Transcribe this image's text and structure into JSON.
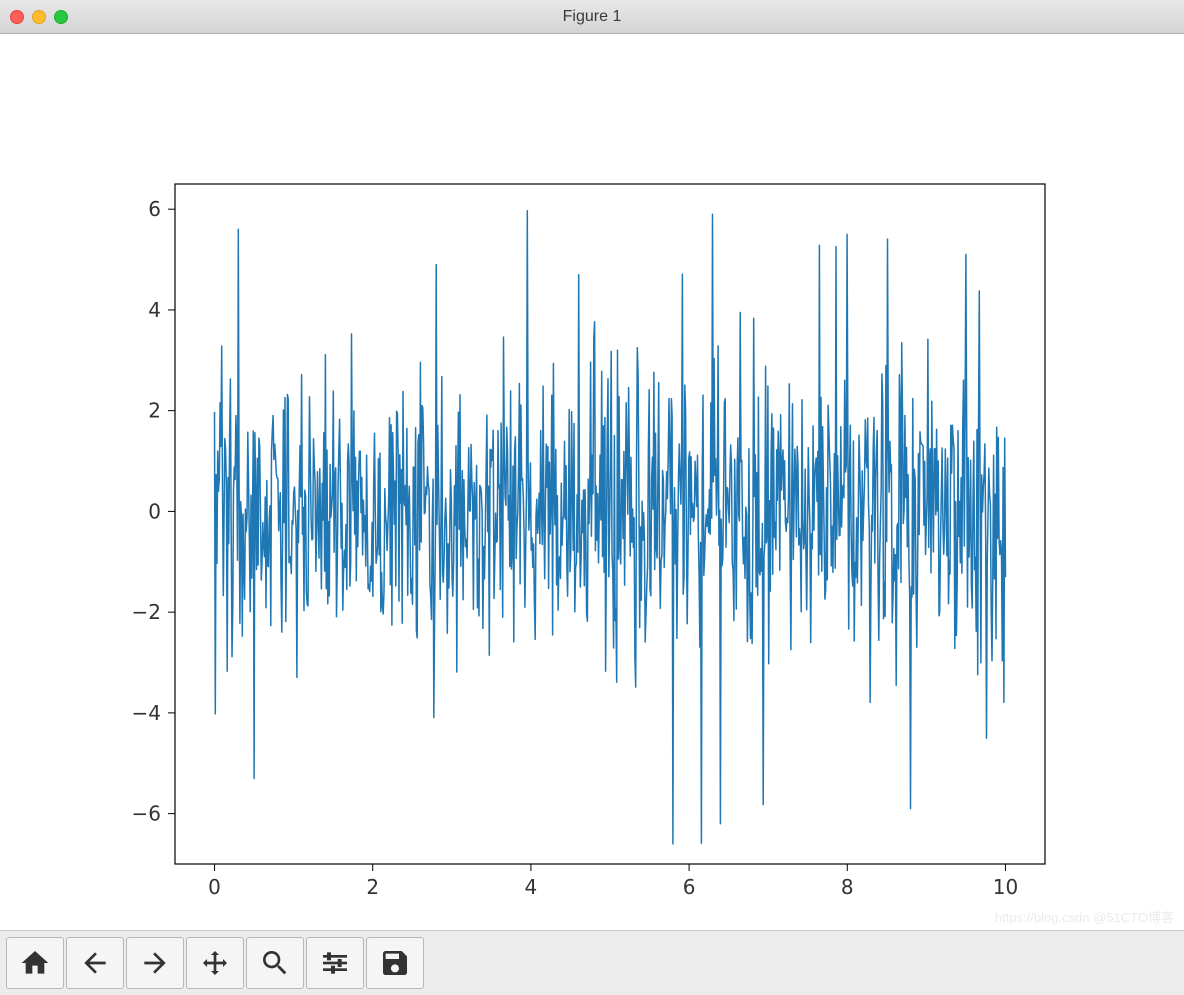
{
  "window": {
    "title": "Figure 1"
  },
  "toolbar": {
    "home": "Home",
    "back": "Back",
    "forward": "Forward",
    "pan": "Pan",
    "zoom": "Zoom",
    "configure": "Configure subplots",
    "save": "Save"
  },
  "watermark": "https://blog.csdn @51CTO博客",
  "chart_data": {
    "type": "line",
    "title": "",
    "xlabel": "",
    "ylabel": "",
    "xlim": [
      -0.5,
      10.5
    ],
    "ylim": [
      -7.0,
      6.5
    ],
    "xticks": [
      0,
      2,
      4,
      6,
      8,
      10
    ],
    "yticks": [
      -6,
      -4,
      -2,
      0,
      2,
      4,
      6
    ],
    "color": "#1f77b4",
    "description": "Dense noisy signal (~1000 samples) over x in [0,10], values roughly Gaussian around 0 with occasional spikes up to ~6 and down to ~-6.6",
    "n_points": 1000,
    "x_range": [
      0,
      10
    ],
    "seed_hint": "random_normal_like",
    "notable_peaks": [
      {
        "x": 0.3,
        "y": 5.6
      },
      {
        "x": 0.5,
        "y": -5.3
      },
      {
        "x": 2.8,
        "y": 4.9
      },
      {
        "x": 4.6,
        "y": 4.7
      },
      {
        "x": 5.8,
        "y": -6.6
      },
      {
        "x": 6.3,
        "y": 5.9
      },
      {
        "x": 6.4,
        "y": -6.2
      },
      {
        "x": 8.0,
        "y": 5.5
      },
      {
        "x": 8.8,
        "y": 5.6
      },
      {
        "x": 8.8,
        "y": -5.9
      },
      {
        "x": 9.5,
        "y": 5.1
      }
    ]
  }
}
